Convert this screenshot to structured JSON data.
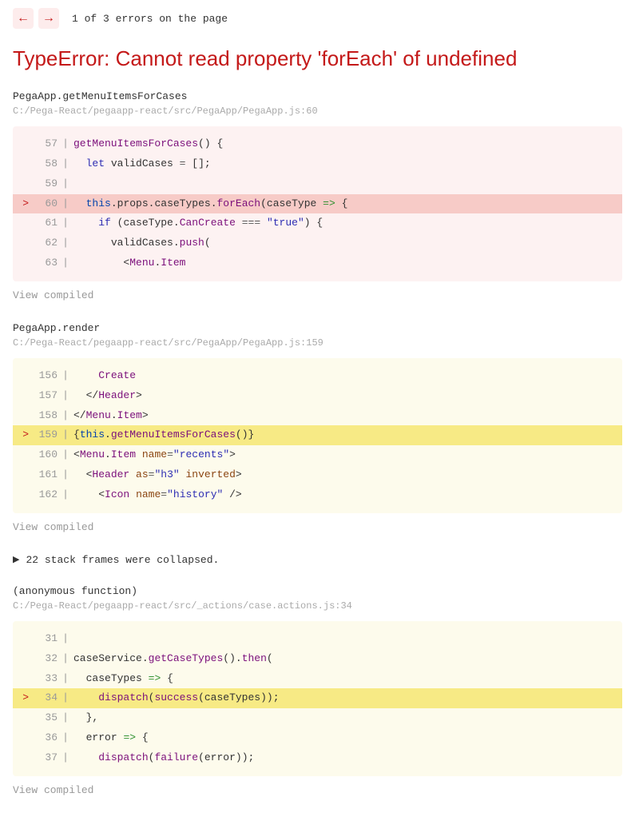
{
  "nav": {
    "prev": "←",
    "next": "→",
    "counter": "1 of 3 errors on the page"
  },
  "errorTitle": "TypeError: Cannot read property 'forEach' of undefined",
  "viewCompiledLabel": "View compiled",
  "collapsed": {
    "arrow": "▶",
    "text": "22 stack frames were collapsed."
  },
  "frames": {
    "f1": {
      "func": "PegaApp.getMenuItemsForCases",
      "loc": "C:/Pega-React/pegaapp-react/src/PegaApp/PegaApp.js:60",
      "lines": {
        "l57": {
          "n": "57",
          "caret": "",
          "pre": "",
          "tokens": [
            "getMenuItemsForCases",
            "()",
            " ",
            "{"
          ]
        },
        "l58": {
          "n": "58",
          "caret": "",
          "pre": "  ",
          "tokens": [
            "let",
            " ",
            "validCases",
            " ",
            "=",
            " ",
            "[",
            "]",
            ";"
          ]
        },
        "l59": {
          "n": "59",
          "caret": "",
          "pre": "",
          "tokens": []
        },
        "l60": {
          "n": "60",
          "caret": ">",
          "pre": "  ",
          "tokens": [
            "this",
            ".",
            "props",
            ".",
            "caseTypes",
            ".",
            "forEach",
            "(",
            "caseType",
            " ",
            "=>",
            " ",
            "{"
          ]
        },
        "l61": {
          "n": "61",
          "caret": "",
          "pre": "    ",
          "tokens": [
            "if",
            " ",
            "(",
            "caseType",
            ".",
            "CanCreate",
            " ",
            "===",
            " ",
            "\"true\"",
            ")",
            " ",
            "{"
          ]
        },
        "l62": {
          "n": "62",
          "caret": "",
          "pre": "      ",
          "tokens": [
            "validCases",
            ".",
            "push",
            "("
          ]
        },
        "l63": {
          "n": "63",
          "caret": "",
          "pre": "        ",
          "tokens": [
            "<",
            "Menu",
            ".",
            "Item"
          ]
        }
      }
    },
    "f2": {
      "func": "PegaApp.render",
      "loc": "C:/Pega-React/pegaapp-react/src/PegaApp/PegaApp.js:159",
      "lines": {
        "l156": {
          "n": "156",
          "caret": "",
          "pre": "    ",
          "tokens": [
            "Create"
          ]
        },
        "l157": {
          "n": "157",
          "caret": "",
          "pre": "  ",
          "tokens": [
            "</",
            "Header",
            ">"
          ]
        },
        "l158": {
          "n": "158",
          "caret": "",
          "pre": "",
          "tokens": [
            "</",
            "Menu",
            ".",
            "Item",
            ">"
          ]
        },
        "l159": {
          "n": "159",
          "caret": ">",
          "pre": "",
          "tokens": [
            "{",
            "this",
            ".",
            "getMenuItemsForCases",
            "(",
            ")",
            "}"
          ]
        },
        "l160": {
          "n": "160",
          "caret": "",
          "pre": "",
          "tokens": [
            "<",
            "Menu",
            ".",
            "Item",
            " ",
            "name",
            "=",
            "\"recents\"",
            ">"
          ]
        },
        "l161": {
          "n": "161",
          "caret": "",
          "pre": "  ",
          "tokens": [
            "<",
            "Header",
            " ",
            "as",
            "=",
            "\"h3\"",
            " ",
            "inverted",
            ">"
          ]
        },
        "l162": {
          "n": "162",
          "caret": "",
          "pre": "    ",
          "tokens": [
            "<",
            "Icon",
            " ",
            "name",
            "=",
            "\"history\"",
            " ",
            "/>"
          ]
        }
      }
    },
    "f3": {
      "func": "(anonymous function)",
      "loc": "C:/Pega-React/pegaapp-react/src/_actions/case.actions.js:34",
      "lines": {
        "l31": {
          "n": "31",
          "caret": "",
          "pre": "",
          "tokens": []
        },
        "l32": {
          "n": "32",
          "caret": "",
          "pre": "",
          "tokens": [
            "caseService",
            ".",
            "getCaseTypes",
            "(",
            ")",
            ".",
            "then",
            "("
          ]
        },
        "l33": {
          "n": "33",
          "caret": "",
          "pre": "  ",
          "tokens": [
            "caseTypes",
            " ",
            "=>",
            " ",
            "{"
          ]
        },
        "l34": {
          "n": "34",
          "caret": ">",
          "pre": "    ",
          "tokens": [
            "dispatch",
            "(",
            "success",
            "(",
            "caseTypes",
            ")",
            ")",
            ";"
          ]
        },
        "l35": {
          "n": "35",
          "caret": "",
          "pre": "  ",
          "tokens": [
            "}",
            ","
          ]
        },
        "l36": {
          "n": "36",
          "caret": "",
          "pre": "  ",
          "tokens": [
            "error",
            " ",
            "=>",
            " ",
            "{"
          ]
        },
        "l37": {
          "n": "37",
          "caret": "",
          "pre": "    ",
          "tokens": [
            "dispatch",
            "(",
            "failure",
            "(",
            "error",
            ")",
            ")",
            ";"
          ]
        }
      }
    }
  }
}
